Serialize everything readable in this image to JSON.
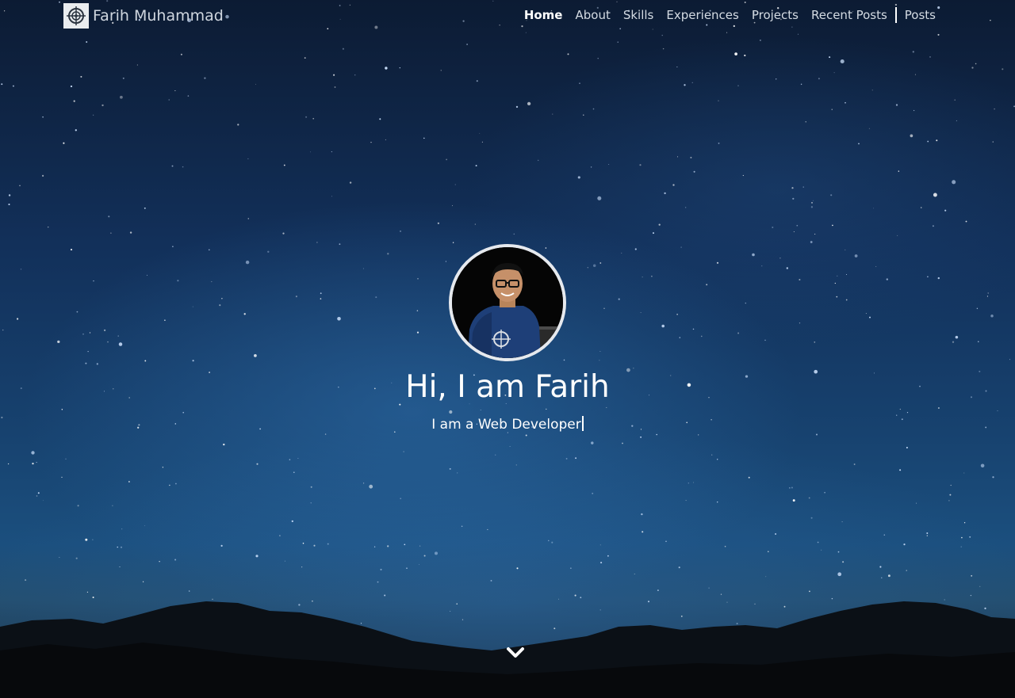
{
  "brand": {
    "name": "Farih Muhammad",
    "logo_icon": "compass-logo-icon"
  },
  "nav": {
    "items": [
      {
        "label": "Home",
        "active": true
      },
      {
        "label": "About",
        "active": false
      },
      {
        "label": "Skills",
        "active": false
      },
      {
        "label": "Experiences",
        "active": false
      },
      {
        "label": "Projects",
        "active": false
      },
      {
        "label": "Recent Posts",
        "active": false
      },
      {
        "label": "Posts",
        "active": false
      }
    ]
  },
  "hero": {
    "title": "Hi, I am Farih",
    "subtitle": "I am a Web Developer",
    "scroll_icon": "chevron-down-icon"
  },
  "colors": {
    "text": "#ffffff",
    "nav_text": "#d4dbe3",
    "avatar_border": "#e6e9ee"
  }
}
